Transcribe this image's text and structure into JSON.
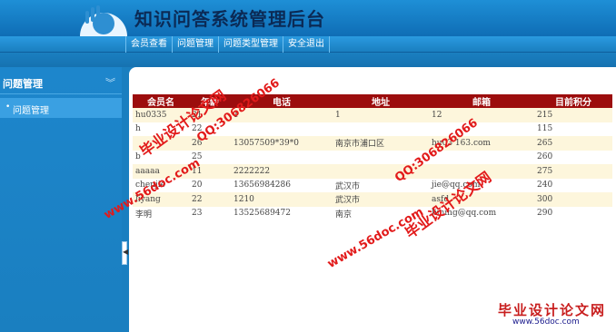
{
  "app": {
    "title": "知识问答系统管理后台"
  },
  "nav": {
    "tabs": [
      {
        "label": "会员查看"
      },
      {
        "label": "问题管理"
      },
      {
        "label": "问题类型管理"
      },
      {
        "label": "安全退出"
      }
    ]
  },
  "sidebar": {
    "title": "问题管理",
    "chevron": "︾",
    "items": [
      {
        "bullet": "•",
        "label": "问题管理"
      }
    ]
  },
  "splitter": {
    "arrow": "◀"
  },
  "table": {
    "headers": [
      "会员名",
      "年龄",
      "电话",
      "地址",
      "邮箱",
      "目前积分"
    ],
    "rows": [
      [
        "hu0335",
        "21",
        "1",
        "1",
        "12",
        "215"
      ],
      [
        "h",
        "22",
        "",
        "",
        "",
        "115"
      ],
      [
        "",
        "26",
        "13057509*39*0",
        "南京市浦口区",
        "hu03 163.com",
        "265"
      ],
      [
        "b",
        "25",
        "",
        "",
        "",
        "260"
      ],
      [
        "aaaaa",
        "11",
        "2222222",
        "",
        "",
        "275"
      ],
      [
        "chenjie",
        "20",
        "13656984286",
        "武汉市",
        "jie@qq.com",
        "240"
      ],
      [
        "liyang",
        "22",
        "1210",
        "武汉市",
        "asfd",
        "300"
      ],
      [
        "李明",
        "23",
        "13525689472",
        "南京",
        "liming@qq.com",
        "290"
      ]
    ]
  },
  "watermarks": {
    "w1": "毕业设计论文网",
    "w2": "QQ:306826066",
    "w3": "www.56doc.com",
    "w4": "QQ:306826066",
    "w5": "毕业设计论文网",
    "w6": "www.56doc.com"
  },
  "footer": {
    "brand": "毕业设计论文网",
    "url": "www.56doc.com"
  }
}
